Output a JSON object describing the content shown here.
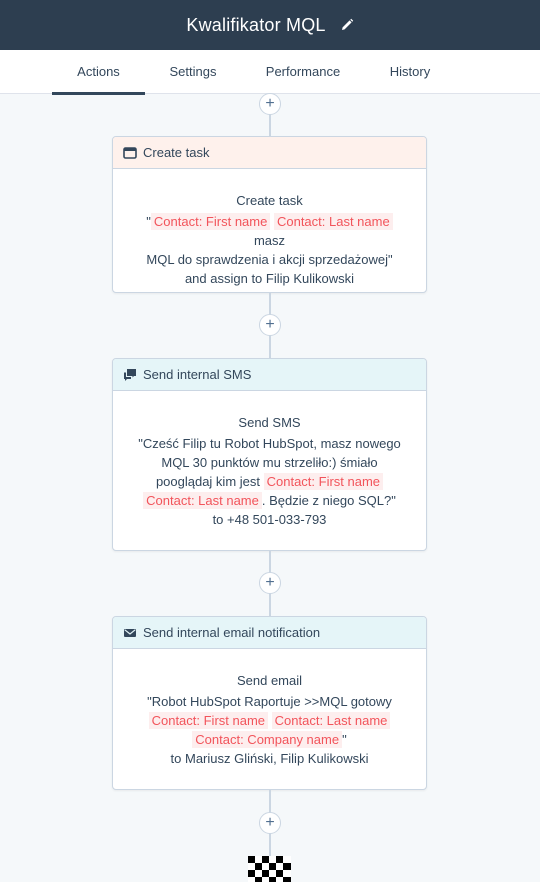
{
  "header": {
    "title": "Kwalifikator MQL",
    "edit_icon": "pencil-icon"
  },
  "tabs": [
    {
      "label": "Actions",
      "active": true
    },
    {
      "label": "Settings",
      "active": false
    },
    {
      "label": "Performance",
      "active": false
    },
    {
      "label": "History",
      "active": false
    }
  ],
  "plus_glyph": "+",
  "colors": {
    "topbar": "#2d3e50",
    "token_text": "#f2545b",
    "token_bg": "#fdeeee",
    "task_header": "#fef1ec",
    "notify_header": "#e5f5f8"
  },
  "actions": [
    {
      "header": "Create task",
      "icon": "task-icon",
      "label": "Create task",
      "token1": "Contact: First name",
      "token2": "Contact: Last name",
      "text1": "masz",
      "text2": "MQL do sprawdzenia i akcji sprzedażowej\"",
      "assign_prefix": "and assign to ",
      "assignee": "Filip Kulikowski"
    },
    {
      "header": "Send internal SMS",
      "icon": "sms-icon",
      "label": "Send SMS",
      "line1": "\"Cześć Filip tu Robot HubSpot, masz nowego",
      "line2": "MQL 30 punktów mu strzeliło:) śmiało",
      "line3": "pooglądaj kim jest ",
      "token1": "Contact: First name",
      "token2": "Contact: Last name",
      "line4": ". Będzie z niego SQL?\"",
      "recipient": "to +48 501-033-793"
    },
    {
      "header": "Send internal email notification",
      "icon": "email-icon",
      "label": "Send email",
      "line1": "\"Robot HubSpot Raportuje >>MQL gotowy",
      "token1": "Contact: First name",
      "token2": "Contact: Last name",
      "token3": "Contact: Company name",
      "recipients": "to Mariusz Gliński, Filip Kulikowski"
    }
  ]
}
